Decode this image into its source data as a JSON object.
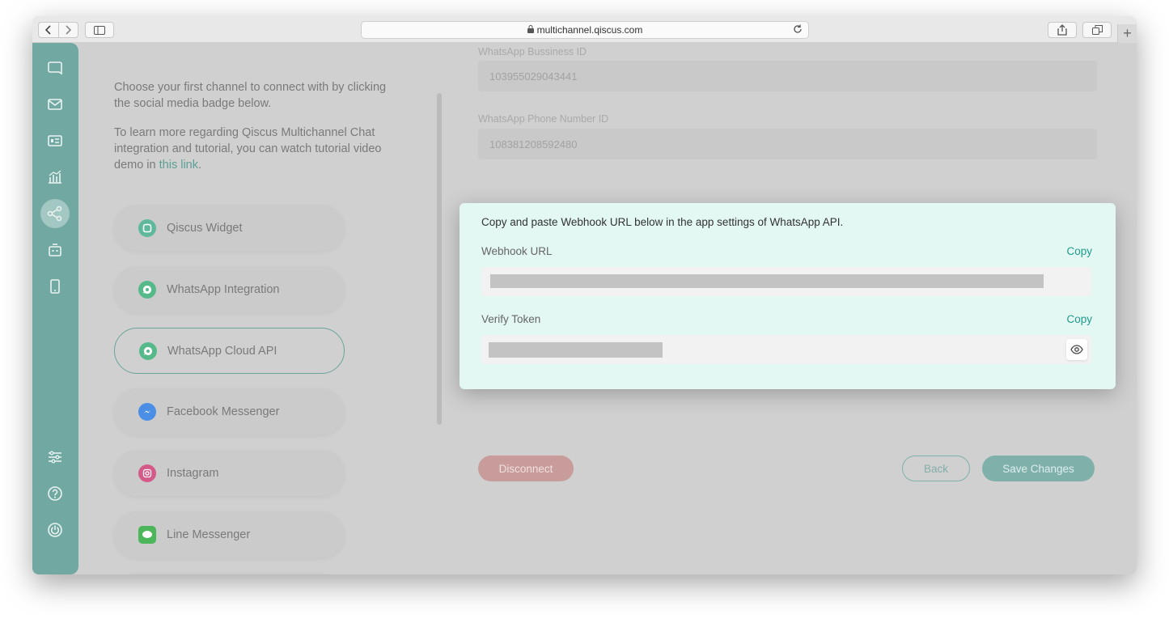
{
  "browser": {
    "url": "multichannel.qiscus.com"
  },
  "intro": {
    "line1": "Choose your first channel to connect with by clicking the social media badge below.",
    "line2_prefix": "To learn more regarding Qiscus Multichannel Chat integration and tutorial, you can watch tutorial video demo in ",
    "line2_link": "this link",
    "line2_suffix": "."
  },
  "channels": [
    {
      "label": "Qiscus Widget",
      "icon": "qiscus-widget-icon",
      "color": "#5fb89c"
    },
    {
      "label": "WhatsApp Integration",
      "icon": "whatsapp-icon",
      "color": "#55b98a"
    },
    {
      "label": "WhatsApp Cloud API",
      "icon": "whatsapp-icon",
      "color": "#55b98a",
      "selected": true
    },
    {
      "label": "Facebook Messenger",
      "icon": "messenger-icon",
      "color": "#4a8ee6"
    },
    {
      "label": "Instagram",
      "icon": "instagram-icon",
      "color": "#d45a8a"
    },
    {
      "label": "Line Messenger",
      "icon": "line-icon",
      "color": "#4cb65a"
    }
  ],
  "form": {
    "business_id_label": "WhatsApp Bussiness ID",
    "business_id_value": "103955029043441",
    "phone_id_label": "WhatsApp Phone Number ID",
    "phone_id_value": "108381208592480"
  },
  "modal": {
    "instruction": "Copy and paste Webhook URL below in the app settings of WhatsApp API.",
    "webhook_label": "Webhook URL",
    "verify_label": "Verify Token",
    "copy_label": "Copy"
  },
  "buttons": {
    "disconnect": "Disconnect",
    "back": "Back",
    "save": "Save Changes"
  },
  "colors": {
    "sidebar": "#72a8a2",
    "accent": "#1f9a8a",
    "modal_bg": "#e3f7f3"
  }
}
